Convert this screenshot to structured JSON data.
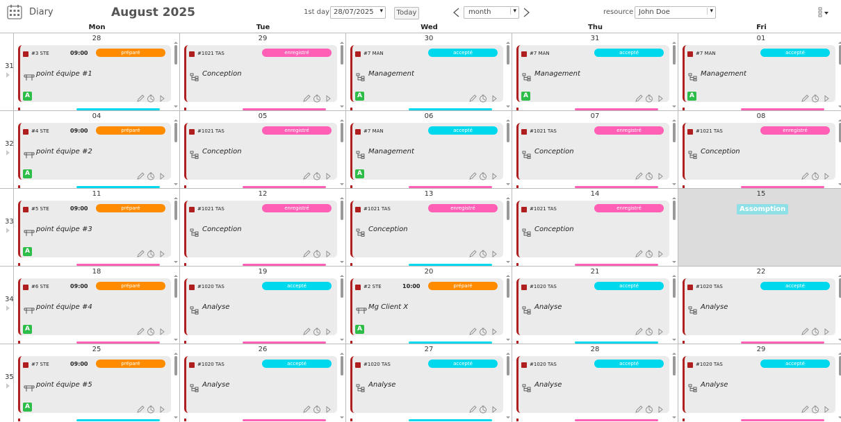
{
  "header": {
    "app_title": "Diary",
    "month_title": "August 2025",
    "first_day_label": "1st day",
    "first_day_value": "28/07/2025",
    "today_label": "Today",
    "view_value": "month",
    "resource_label": "resource",
    "resource_value": "John Doe"
  },
  "day_headers": [
    "Mon",
    "Tue",
    "Wed",
    "Thu",
    "Fri"
  ],
  "colors": {
    "accent_red": "#b01f1f",
    "status_prepare": "#ff8c00",
    "status_enregistre": "#ff5fb4",
    "status_accepte": "#00d8ee",
    "holiday": "#8fe0e6",
    "green_badge": "#2fbd4a"
  },
  "weeks": [
    {
      "number": "31",
      "days": [
        {
          "date": "28",
          "event": {
            "code": "#3 STE",
            "time": "09:00",
            "status": "préparé",
            "status_color": "#ff8c00",
            "icon": "meeting-table-icon",
            "title": "point équipe #1",
            "badge": "A"
          },
          "next_color": "#00d8ee"
        },
        {
          "date": "29",
          "event": {
            "code": "#1021 TAS",
            "time": "",
            "status": "enregistré",
            "status_color": "#ff5fb4",
            "icon": "sitemap-icon",
            "title": "Conception",
            "badge": ""
          },
          "next_color": "#ff5fb4"
        },
        {
          "date": "30",
          "event": {
            "code": "#7 MAN",
            "time": "",
            "status": "accepté",
            "status_color": "#00d8ee",
            "icon": "sitemap-icon",
            "title": "Management",
            "badge": "A"
          },
          "next_color": "#00d8ee"
        },
        {
          "date": "31",
          "event": {
            "code": "#7 MAN",
            "time": "",
            "status": "accepté",
            "status_color": "#00d8ee",
            "icon": "sitemap-icon",
            "title": "Management",
            "badge": "A"
          },
          "next_color": "#ff5fb4"
        },
        {
          "date": "01",
          "event": {
            "code": "#7 MAN",
            "time": "",
            "status": "accepté",
            "status_color": "#00d8ee",
            "icon": "sitemap-icon",
            "title": "Management",
            "badge": "A"
          },
          "next_color": "#ff5fb4"
        }
      ]
    },
    {
      "number": "32",
      "days": [
        {
          "date": "04",
          "event": {
            "code": "#4 STE",
            "time": "09:00",
            "status": "préparé",
            "status_color": "#ff8c00",
            "icon": "meeting-table-icon",
            "title": "point équipe #2",
            "badge": "A"
          },
          "next_color": "#00d8ee"
        },
        {
          "date": "05",
          "event": {
            "code": "#1021 TAS",
            "time": "",
            "status": "enregistré",
            "status_color": "#ff5fb4",
            "icon": "sitemap-icon",
            "title": "Conception",
            "badge": ""
          },
          "next_color": "#ff5fb4"
        },
        {
          "date": "06",
          "event": {
            "code": "#7 MAN",
            "time": "",
            "status": "accepté",
            "status_color": "#00d8ee",
            "icon": "sitemap-icon",
            "title": "Management",
            "badge": "A"
          },
          "next_color": "#ff5fb4"
        },
        {
          "date": "07",
          "event": {
            "code": "#1021 TAS",
            "time": "",
            "status": "enregistré",
            "status_color": "#ff5fb4",
            "icon": "sitemap-icon",
            "title": "Conception",
            "badge": ""
          },
          "next_color": "#ff5fb4"
        },
        {
          "date": "08",
          "event": {
            "code": "#1021 TAS",
            "time": "",
            "status": "enregistré",
            "status_color": "#ff5fb4",
            "icon": "sitemap-icon",
            "title": "Conception",
            "badge": ""
          },
          "next_color": "#ff5fb4"
        }
      ]
    },
    {
      "number": "33",
      "days": [
        {
          "date": "11",
          "event": {
            "code": "#5 STE",
            "time": "09:00",
            "status": "préparé",
            "status_color": "#ff8c00",
            "icon": "meeting-table-icon",
            "title": "point équipe #3",
            "badge": "A"
          },
          "next_color": "#ff5fb4"
        },
        {
          "date": "12",
          "event": {
            "code": "#1021 TAS",
            "time": "",
            "status": "enregistré",
            "status_color": "#ff5fb4",
            "icon": "sitemap-icon",
            "title": "Conception",
            "badge": ""
          },
          "next_color": "#ff5fb4"
        },
        {
          "date": "13",
          "event": {
            "code": "#1021 TAS",
            "time": "",
            "status": "enregistré",
            "status_color": "#ff5fb4",
            "icon": "sitemap-icon",
            "title": "Conception",
            "badge": ""
          },
          "next_color": "#00d8ee"
        },
        {
          "date": "14",
          "event": {
            "code": "#1021 TAS",
            "time": "",
            "status": "enregistré",
            "status_color": "#ff5fb4",
            "icon": "sitemap-icon",
            "title": "Conception",
            "badge": ""
          },
          "next_color": "#ff5fb4"
        },
        {
          "date": "15",
          "holiday": "Assomption"
        }
      ]
    },
    {
      "number": "34",
      "days": [
        {
          "date": "18",
          "event": {
            "code": "#6 STE",
            "time": "09:00",
            "status": "préparé",
            "status_color": "#ff8c00",
            "icon": "meeting-table-icon",
            "title": "point équipe #4",
            "badge": "A"
          },
          "next_color": "#ff5fb4"
        },
        {
          "date": "19",
          "event": {
            "code": "#1020 TAS",
            "time": "",
            "status": "accepté",
            "status_color": "#00d8ee",
            "icon": "sitemap-icon",
            "title": "Analyse",
            "badge": ""
          },
          "next_color": "#ff5fb4"
        },
        {
          "date": "20",
          "event": {
            "code": "#2 STE",
            "time": "10:00",
            "status": "préparé",
            "status_color": "#ff8c00",
            "icon": "meeting-table-icon",
            "title": "Mg Client X",
            "badge": "A"
          },
          "next_color": "#00d8ee"
        },
        {
          "date": "21",
          "event": {
            "code": "#1020 TAS",
            "time": "",
            "status": "accepté",
            "status_color": "#00d8ee",
            "icon": "sitemap-icon",
            "title": "Analyse",
            "badge": ""
          },
          "next_color": "#00d8ee"
        },
        {
          "date": "22",
          "event": {
            "code": "#1020 TAS",
            "time": "",
            "status": "accepté",
            "status_color": "#00d8ee",
            "icon": "sitemap-icon",
            "title": "Analyse",
            "badge": ""
          },
          "next_color": "#ff5fb4"
        }
      ]
    },
    {
      "number": "35",
      "days": [
        {
          "date": "25",
          "event": {
            "code": "#7 STE",
            "time": "09:00",
            "status": "préparé",
            "status_color": "#ff8c00",
            "icon": "meeting-table-icon",
            "title": "point équipe #5",
            "badge": "A"
          },
          "next_color": "#00d8ee"
        },
        {
          "date": "26",
          "event": {
            "code": "#1020 TAS",
            "time": "",
            "status": "accepté",
            "status_color": "#00d8ee",
            "icon": "sitemap-icon",
            "title": "Analyse",
            "badge": ""
          },
          "next_color": "#ff5fb4"
        },
        {
          "date": "27",
          "event": {
            "code": "#1020 TAS",
            "time": "",
            "status": "accepté",
            "status_color": "#00d8ee",
            "icon": "sitemap-icon",
            "title": "Analyse",
            "badge": ""
          },
          "next_color": "#00d8ee"
        },
        {
          "date": "28",
          "event": {
            "code": "#1020 TAS",
            "time": "",
            "status": "accepté",
            "status_color": "#00d8ee",
            "icon": "sitemap-icon",
            "title": "Analyse",
            "badge": ""
          },
          "next_color": "#ff5fb4"
        },
        {
          "date": "29",
          "event": {
            "code": "#1020 TAS",
            "time": "",
            "status": "accepté",
            "status_color": "#00d8ee",
            "icon": "sitemap-icon",
            "title": "Analyse",
            "badge": ""
          },
          "next_color": "#ff5fb4"
        }
      ]
    }
  ]
}
